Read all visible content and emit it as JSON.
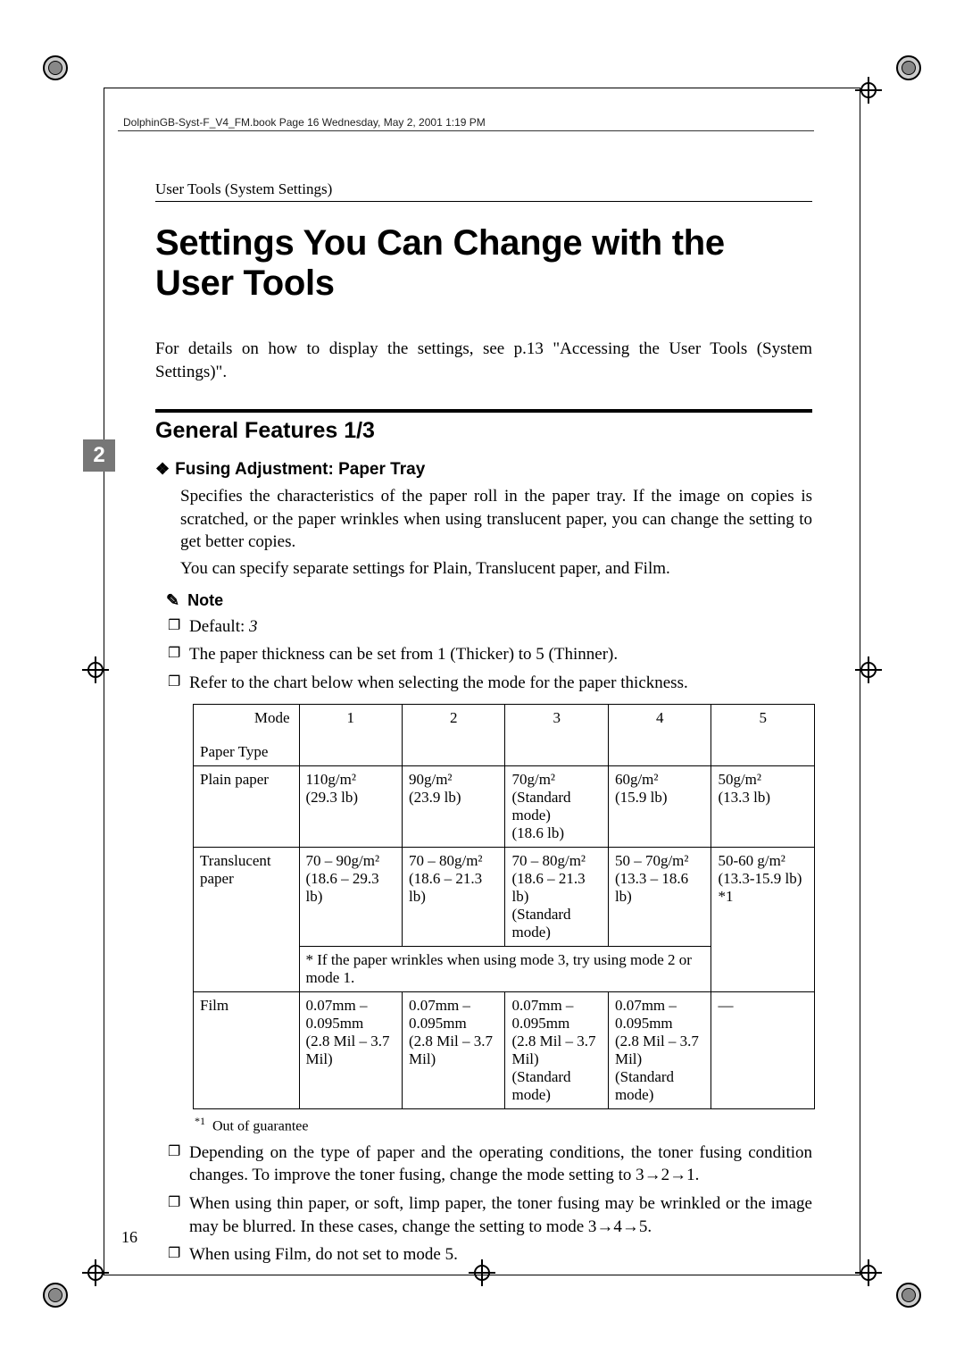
{
  "book_header": "DolphinGB-Syst-F_V4_FM.book  Page 16  Wednesday, May 2, 2001  1:19 PM",
  "running_head": "User Tools (System Settings)",
  "title": "Settings You Can Change with the User Tools",
  "intro": "For details on how to display the settings, see p.13 \"Accessing the User Tools (System Settings)\".",
  "side_tab": "2",
  "section_title": "General Features 1/3",
  "feature": {
    "heading": "Fusing Adjustment: Paper Tray",
    "p1": "Specifies the characteristics of the paper roll in the paper tray. If the image on copies is scratched, or the paper wrinkles when using translucent paper, you can change the setting to get better copies.",
    "p2": "You can specify separate settings for Plain, Translucent paper, and Film."
  },
  "note_label": "Note",
  "notes_above": {
    "n1_prefix": "Default: ",
    "n1_value": "3",
    "n2": "The paper thickness can be set from 1 (Thicker) to 5 (Thinner).",
    "n3": "Refer to the chart below when selecting the mode for the paper thickness."
  },
  "table": {
    "header_mode": "Mode",
    "header_paper_type": "Paper Type",
    "cols": [
      "1",
      "2",
      "3",
      "4",
      "5"
    ],
    "rows": {
      "plain": {
        "label": "Plain paper",
        "c1": "110g/m²\n(29.3 lb)",
        "c2": "90g/m²\n(23.9 lb)",
        "c3": "70g/m²\n(Standard mode)\n(18.6 lb)",
        "c4": "60g/m²\n(15.9 lb)",
        "c5": "50g/m²\n(13.3 lb)"
      },
      "translucent": {
        "label": "Translucent paper",
        "c1": "70 – 90g/m²\n(18.6 – 29.3 lb)",
        "c2": "70 – 80g/m²\n(18.6 – 21.3 lb)",
        "c3": "70 – 80g/m²\n(18.6 – 21.3 lb)\n(Standard mode)",
        "c4": "50 – 70g/m²\n(13.3 – 18.6 lb)",
        "c5": "50-60 g/m²\n(13.3-15.9 lb)\n*1",
        "merged_note": "* If the paper wrinkles when using mode 3, try using mode 2 or mode 1."
      },
      "film": {
        "label": "Film",
        "c1": "0.07mm – 0.095mm\n(2.8 Mil – 3.7 Mil)",
        "c2": "0.07mm – 0.095mm\n(2.8 Mil – 3.7 Mil)",
        "c3": "0.07mm – 0.095mm\n(2.8 Mil – 3.7 Mil) (Standard mode)",
        "c4": "0.07mm – 0.095mm\n(2.8 Mil – 3.7 Mil) (Standard mode)",
        "c5": "—"
      }
    }
  },
  "footnote": {
    "marker": "*1",
    "text": "Out of guarantee"
  },
  "notes_below": {
    "b1": "Depending on the type of paper and the operating conditions, the toner fusing condition changes. To improve the toner fusing, change the mode setting to 3→2→1.",
    "b2": "When using thin paper, or soft, limp paper, the toner fusing may be wrinkled or the image may be blurred. In these cases, change the setting to mode 3→4→5.",
    "b3": "When using Film, do not set to mode 5."
  },
  "page_number": "16"
}
